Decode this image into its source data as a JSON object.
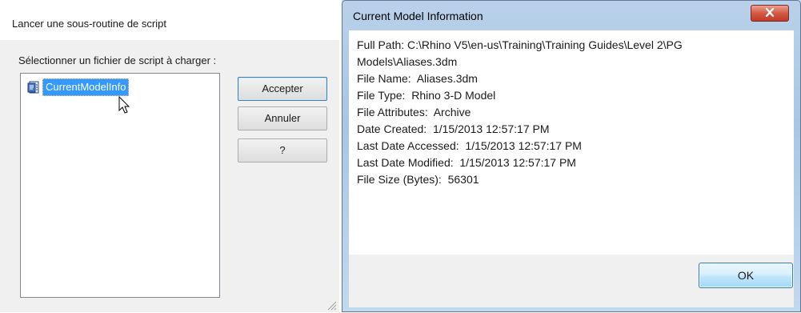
{
  "left_dialog": {
    "title": "Lancer une sous-routine de script",
    "prompt": "Sélectionner un fichier de script à charger :",
    "files": [
      {
        "name": "CurrentModelInfo",
        "icon": "script-file-icon",
        "selected": true
      }
    ],
    "buttons": {
      "accept": "Accepter",
      "cancel": "Annuler",
      "help": "?"
    }
  },
  "right_dialog": {
    "title": "Current Model Information",
    "info": {
      "full_path": "Full Path:  C:\\Rhino V5\\en-us\\Training\\Training Guides\\Level 2\\PG Models\\Aliases.3dm",
      "file_name": "File Name:  Aliases.3dm",
      "file_type": "File Type:  Rhino 3-D Model",
      "file_attributes": "File Attributes:  Archive",
      "date_created": "Date Created:  1/15/2013 12:57:17 PM",
      "last_accessed": "Last Date Accessed:  1/15/2013 12:57:17 PM",
      "last_modified": "Last Date Modified:  1/15/2013 12:57:17 PM",
      "file_size": "File Size (Bytes):  56301"
    },
    "ok_label": "OK"
  },
  "colors": {
    "selection": "#3399ff",
    "close_button": "#c13a26",
    "frame": "#b9d1ea"
  }
}
